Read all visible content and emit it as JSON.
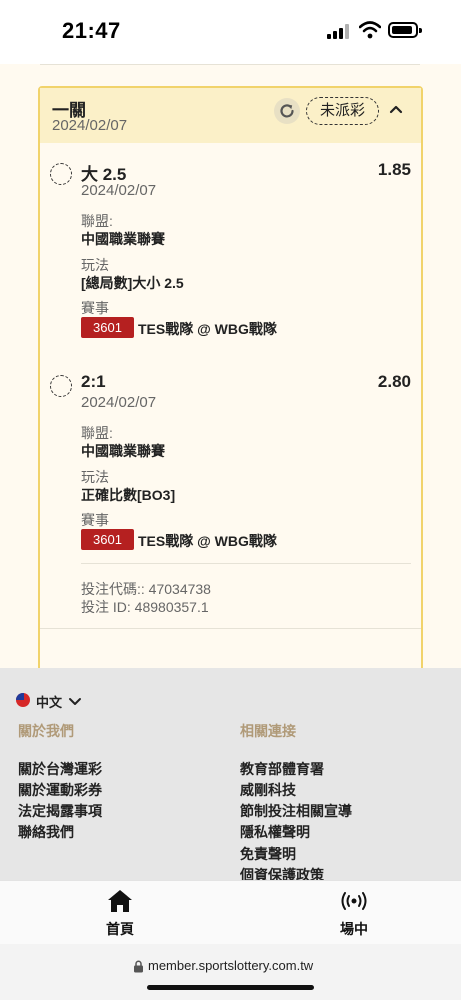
{
  "status_bar": {
    "time": "21:47"
  },
  "ticket": {
    "title": "一關",
    "date": "2024/02/07",
    "status": "未派彩",
    "selections": [
      {
        "name": "大 2.5",
        "odds": "1.85",
        "date": "2024/02/07",
        "league_label": "聯盟:",
        "league": "中國職業聯賽",
        "market_label": "玩法",
        "market": "[總局數]大小 2.5",
        "event_label": "賽事",
        "event_code": "3601",
        "event": "TES戰隊 @ WBG戰隊"
      },
      {
        "name": "2:1",
        "odds": "2.80",
        "date": "2024/02/07",
        "league_label": "聯盟:",
        "league": "中國職業聯賽",
        "market_label": "玩法",
        "market": "正確比數[BO3]",
        "event_label": "賽事",
        "event_code": "3601",
        "event": "TES戰隊 @ WBG戰隊"
      }
    ],
    "bet_code": "投注代碼:: 47034738",
    "bet_id": "投注 ID: 48980357.1"
  },
  "footer": {
    "language": "中文",
    "about_heading": "關於我們",
    "about_links": [
      "關於台灣運彩",
      "關於運動彩券",
      "法定揭露事項",
      "聯絡我們"
    ],
    "related_heading": "相關連接",
    "related_links": [
      "教育部體育署",
      "威剛科技",
      "節制投注相關宣導",
      "隱私權聲明",
      "免責聲明",
      "個資保護政策"
    ]
  },
  "bottom_nav": {
    "home_label": "首頁",
    "live_label": "場中"
  },
  "url_bar": {
    "url": "member.sportslottery.com.tw"
  },
  "colors": {
    "ticket_border": "#f1d36b",
    "ticket_header_bg": "#fbf0c8",
    "event_code_badge": "#b52020",
    "footer_heading": "#b09a78"
  }
}
